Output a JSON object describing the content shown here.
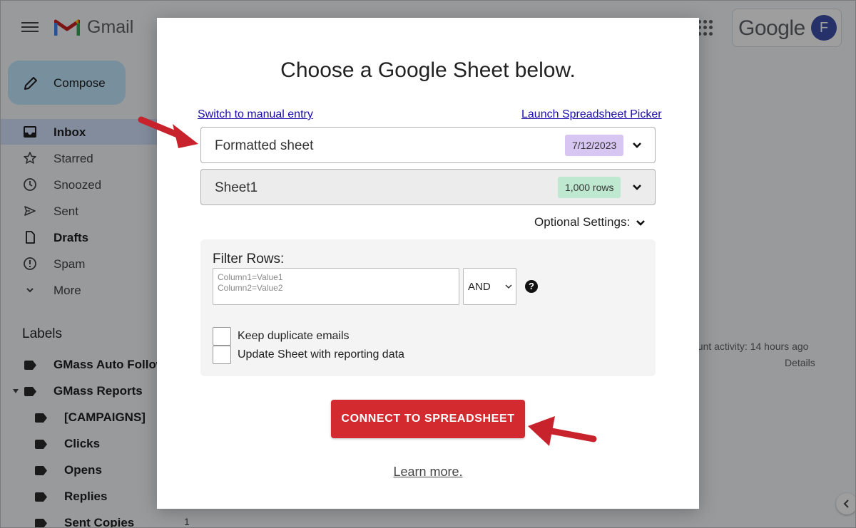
{
  "gmail": {
    "brand": "Gmail",
    "google_logo": "Google",
    "avatar_letter": "F",
    "compose_label": "Compose",
    "nav": [
      {
        "label": "Inbox",
        "icon": "inbox-icon",
        "bold": true,
        "active": true
      },
      {
        "label": "Starred",
        "icon": "star-icon",
        "bold": false
      },
      {
        "label": "Snoozed",
        "icon": "clock-icon",
        "bold": false
      },
      {
        "label": "Sent",
        "icon": "send-icon",
        "bold": false
      },
      {
        "label": "Drafts",
        "icon": "file-icon",
        "bold": true
      },
      {
        "label": "Spam",
        "icon": "alert-icon",
        "bold": false
      },
      {
        "label": "More",
        "icon": "chevron-down-icon",
        "bold": false
      }
    ],
    "labels_title": "Labels",
    "labels": [
      {
        "label": "GMass Auto Follow",
        "indent": false
      },
      {
        "label": "GMass Reports",
        "indent": false,
        "expanded": true
      },
      {
        "label": "[CAMPAIGNS]",
        "indent": true
      },
      {
        "label": "Clicks",
        "indent": true
      },
      {
        "label": "Opens",
        "indent": true
      },
      {
        "label": "Replies",
        "indent": true
      },
      {
        "label": "Sent Copies",
        "indent": true
      }
    ],
    "sent_copies_count": "1",
    "account_activity": "ount activity: 14 hours ago",
    "details": "Details"
  },
  "modal": {
    "title": "Choose a Google Sheet below.",
    "switch_manual": "Switch to manual entry",
    "launch_picker": "Launch Spreadsheet Picker",
    "spreadsheet": {
      "name": "Formatted sheet",
      "date": "7/12/2023"
    },
    "worksheet": {
      "name": "Sheet1",
      "rows": "1,000 rows"
    },
    "optional_settings": "Optional Settings:",
    "filter": {
      "title": "Filter Rows:",
      "placeholder_line1": "Column1=Value1",
      "placeholder_line2": "Column2=Value2",
      "operator": "AND",
      "help": "?"
    },
    "checkboxes": [
      {
        "label": "Keep duplicate emails",
        "checked": false
      },
      {
        "label": "Update Sheet with reporting data",
        "checked": false
      }
    ],
    "connect_button": "CONNECT TO SPREADSHEET",
    "learn_more": "Learn more."
  },
  "colors": {
    "connect_button": "#d32a2f",
    "date_badge": "#d7c6f2",
    "rows_badge": "#bfe8d0",
    "annotation_arrow": "#c8232c",
    "link": "#1a0dab"
  }
}
